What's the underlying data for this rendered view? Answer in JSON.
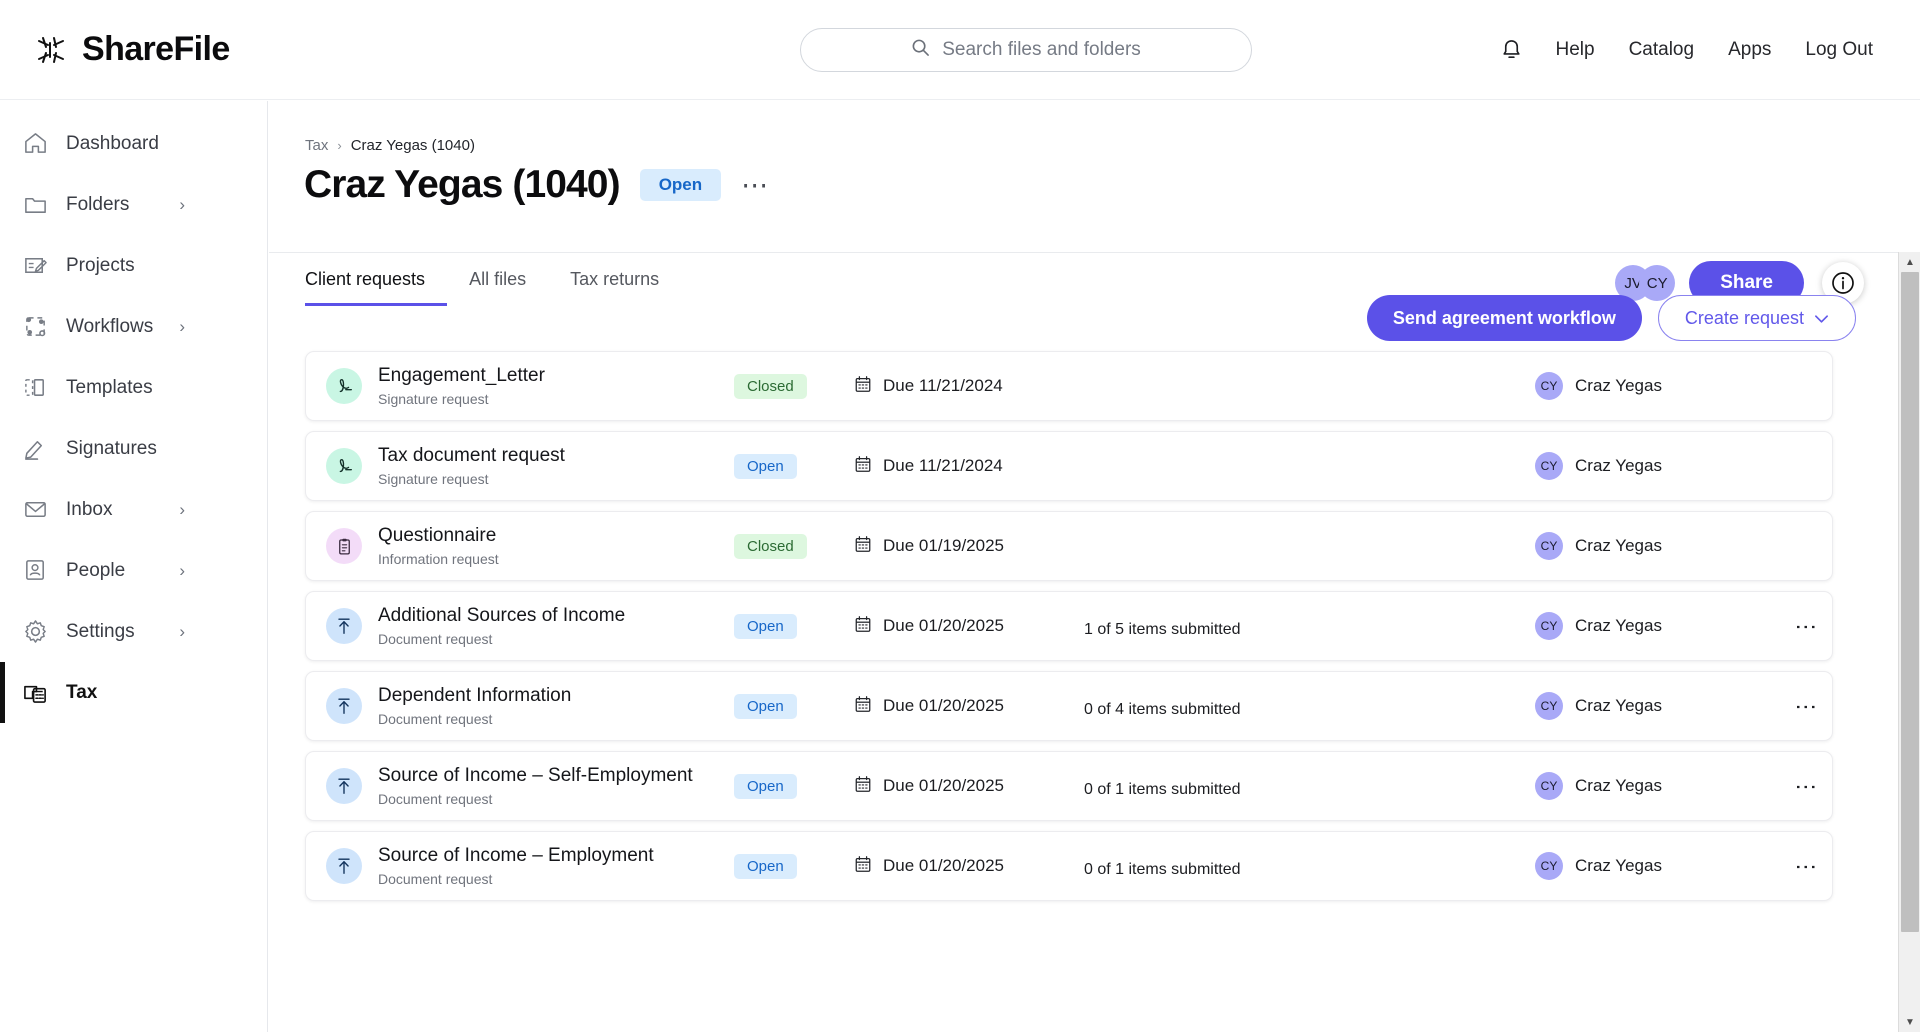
{
  "brand": {
    "name": "ShareFile",
    "logo_icon": "sharefile-asterisk-icon"
  },
  "search": {
    "placeholder": "Search files and folders",
    "icon": "search-icon"
  },
  "topnav": {
    "notifications_icon": "bell-icon",
    "items": [
      {
        "label": "Help"
      },
      {
        "label": "Catalog"
      },
      {
        "label": "Apps"
      },
      {
        "label": "Log Out"
      }
    ]
  },
  "sidebar": {
    "items": [
      {
        "label": "Dashboard",
        "icon": "home-icon",
        "chevron": false,
        "active": false
      },
      {
        "label": "Folders",
        "icon": "folder-icon",
        "chevron": true,
        "active": false
      },
      {
        "label": "Projects",
        "icon": "projects-icon",
        "chevron": false,
        "active": false
      },
      {
        "label": "Workflows",
        "icon": "workflows-icon",
        "chevron": true,
        "active": false
      },
      {
        "label": "Templates",
        "icon": "templates-icon",
        "chevron": false,
        "active": false
      },
      {
        "label": "Signatures",
        "icon": "signature-pen-icon",
        "chevron": false,
        "active": false
      },
      {
        "label": "Inbox",
        "icon": "mail-icon",
        "chevron": true,
        "active": false
      },
      {
        "label": "People",
        "icon": "people-icon",
        "chevron": true,
        "active": false
      },
      {
        "label": "Settings",
        "icon": "gear-icon",
        "chevron": true,
        "active": false
      },
      {
        "label": "Tax",
        "icon": "tax-calculator-icon",
        "chevron": false,
        "active": true
      }
    ],
    "chevron_glyph": "›"
  },
  "breadcrumb": {
    "root": "Tax",
    "separator": "›",
    "current": "Craz Yegas (1040)"
  },
  "header": {
    "title": "Craz Yegas (1040)",
    "status_pill": "Open",
    "more_glyph": "⋯",
    "avatars": [
      {
        "initials": "JV",
        "color": "#a9a9f7"
      },
      {
        "initials": "CY",
        "color": "#a9a9f7"
      }
    ],
    "share_label": "Share",
    "info_icon": "info-circle-icon"
  },
  "tabs": [
    {
      "label": "Client requests",
      "selected": true
    },
    {
      "label": "All files",
      "selected": false
    },
    {
      "label": "Tax returns",
      "selected": false
    }
  ],
  "toolbar": {
    "send_agreement_label": "Send agreement workflow",
    "create_request_label": "Create request",
    "create_request_chevron": "⌄"
  },
  "colors": {
    "accent": "#5b51e8",
    "pill_open_bg": "#d9ecfd",
    "pill_open_fg": "#1767c8",
    "pill_closed_bg": "#ddf7df",
    "pill_closed_fg": "#2c6b34",
    "icon_signature_bg": "#c9f6e4",
    "icon_information_bg": "#f3dcf8",
    "icon_document_bg": "#cfe4fb"
  },
  "requests": [
    {
      "title": "Engagement_Letter",
      "subtitle": "Signature request",
      "icon": "signature-icon",
      "icon_kind": "sig",
      "status": "Closed",
      "status_kind": "closed",
      "due": "Due 11/21/2024",
      "progress": null,
      "progress_label": null,
      "progress_pct": 0,
      "owner_initials": "CY",
      "owner_name": "Craz Yegas",
      "menu": false
    },
    {
      "title": "Tax document request",
      "subtitle": "Signature request",
      "icon": "signature-icon",
      "icon_kind": "sig",
      "status": "Open",
      "status_kind": "open",
      "due": "Due 11/21/2024",
      "progress": null,
      "progress_label": null,
      "progress_pct": 0,
      "owner_initials": "CY",
      "owner_name": "Craz Yegas",
      "menu": false
    },
    {
      "title": "Questionnaire",
      "subtitle": "Information request",
      "icon": "clipboard-icon",
      "icon_kind": "info",
      "status": "Closed",
      "status_kind": "closed",
      "due": "Due 01/19/2025",
      "progress": null,
      "progress_label": null,
      "progress_pct": 0,
      "owner_initials": "CY",
      "owner_name": "Craz Yegas",
      "menu": false
    },
    {
      "title": "Additional Sources of Income",
      "subtitle": "Document request",
      "icon": "upload-icon",
      "icon_kind": "doc",
      "status": "Open",
      "status_kind": "open",
      "due": "Due 01/20/2025",
      "progress": true,
      "progress_label": "1 of 5 items submitted",
      "progress_pct": 20,
      "owner_initials": "CY",
      "owner_name": "Craz Yegas",
      "menu": true
    },
    {
      "title": "Dependent Information",
      "subtitle": "Document request",
      "icon": "upload-icon",
      "icon_kind": "doc",
      "status": "Open",
      "status_kind": "open",
      "due": "Due 01/20/2025",
      "progress": true,
      "progress_label": "0 of 4 items submitted",
      "progress_pct": 0,
      "owner_initials": "CY",
      "owner_name": "Craz Yegas",
      "menu": true
    },
    {
      "title": "Source of Income – Self-Employment",
      "subtitle": "Document request",
      "icon": "upload-icon",
      "icon_kind": "doc",
      "status": "Open",
      "status_kind": "open",
      "due": "Due 01/20/2025",
      "progress": true,
      "progress_label": "0 of 1 items submitted",
      "progress_pct": 0,
      "owner_initials": "CY",
      "owner_name": "Craz Yegas",
      "menu": true
    },
    {
      "title": "Source of Income – Employment",
      "subtitle": "Document request",
      "icon": "upload-icon",
      "icon_kind": "doc",
      "status": "Open",
      "status_kind": "open",
      "due": "Due 01/20/2025",
      "progress": true,
      "progress_label": "0 of 1 items submitted",
      "progress_pct": 0,
      "owner_initials": "CY",
      "owner_name": "Craz Yegas",
      "menu": true
    }
  ],
  "scrollbar": {
    "up_glyph": "▲",
    "down_glyph": "▼"
  }
}
